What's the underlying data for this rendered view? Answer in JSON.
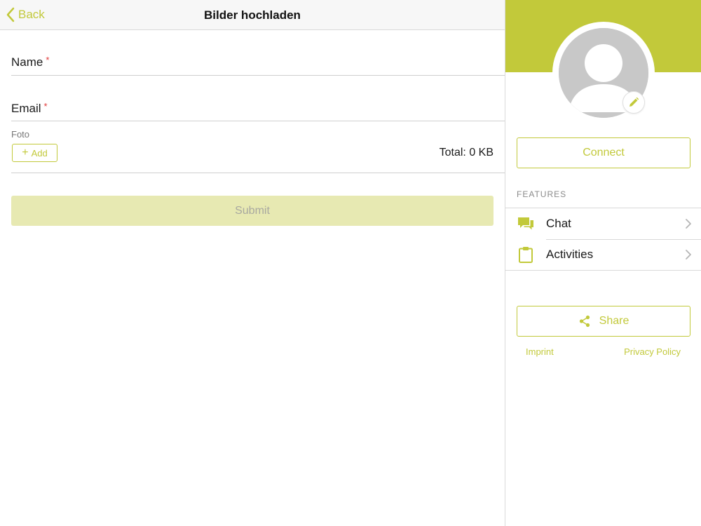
{
  "colors": {
    "accent": "#c2c93a",
    "submit_disabled_bg": "#e7e9b2",
    "required": "#e03a3a"
  },
  "navbar": {
    "back_label": "Back",
    "title": "Bilder hochladen"
  },
  "form": {
    "name_label": "Name",
    "email_label": "Email",
    "required_mark": "*",
    "foto_label": "Foto",
    "add_label": "Add",
    "total_label": "Total: 0 KB",
    "submit_label": "Submit"
  },
  "sidebar": {
    "connect_label": "Connect",
    "features_heading": "FEATURES",
    "features": [
      {
        "label": "Chat",
        "icon": "chat-bubbles-icon"
      },
      {
        "label": "Activities",
        "icon": "clipboard-icon"
      }
    ],
    "share_label": "Share",
    "imprint_label": "Imprint",
    "privacy_label": "Privacy Policy"
  }
}
